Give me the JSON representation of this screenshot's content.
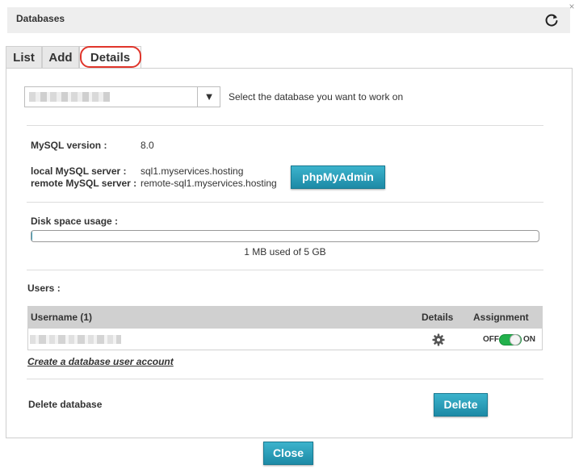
{
  "window": {
    "close_glyph": "×",
    "title": "Databases",
    "refresh_icon": "refresh-icon"
  },
  "tabs": [
    {
      "label": "List",
      "active": false
    },
    {
      "label": "Add",
      "active": false
    },
    {
      "label": "Details",
      "active": true
    }
  ],
  "database_select": {
    "selected_value": "[redacted]",
    "arrow": "▼",
    "hint": "Select the database you want to work on"
  },
  "mysql": {
    "version_label": "MySQL version :",
    "version_value": "8.0",
    "local_label": "local MySQL server :",
    "local_value": "sql1.myservices.hosting",
    "remote_label": "remote MySQL server :",
    "remote_value": "remote-sql1.myservices.hosting",
    "phpmyadmin_label": "phpMyAdmin"
  },
  "disk": {
    "label": "Disk space usage :",
    "used_fraction": 0.0002,
    "usage_text": "1 MB used of 5 GB"
  },
  "users": {
    "section_label": "Users :",
    "columns": {
      "username": "Username (1)",
      "details": "Details",
      "assignment": "Assignment"
    },
    "rows": [
      {
        "username": "[redacted]",
        "details_icon": "gear-icon",
        "toggle_off": "OFF",
        "toggle_on": "ON",
        "assigned": true
      }
    ],
    "create_link": "Create a database user account"
  },
  "delete": {
    "label": "Delete database",
    "button": "Delete"
  },
  "footer": {
    "close_button": "Close"
  },
  "colors": {
    "accent": "#1d8aa6",
    "toggle_on": "#22b14c",
    "highlight": "#e0352b"
  }
}
